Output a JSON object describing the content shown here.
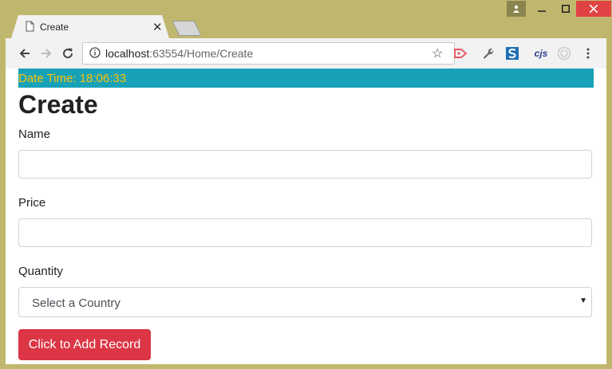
{
  "browser": {
    "tab": {
      "title": "Create"
    },
    "address": {
      "host": "localhost",
      "rest": ":63554/Home/Create"
    },
    "extensions": [
      "arrow-extension-icon",
      "wrench-extension-icon",
      "s-extension-icon",
      "cjs-extension-icon",
      "circle-extension-icon"
    ],
    "ext_cjs_label": "cjs"
  },
  "page": {
    "datetime": "Date Time: 18:06:33",
    "title": "Create",
    "form": {
      "name_label": "Name",
      "price_label": "Price",
      "quantity_label": "Quantity",
      "select_value": "Select a Country",
      "submit_label": "Click to Add Record"
    }
  },
  "colors": {
    "chrome": "#c0b76e",
    "info_bar": "#17a2b8",
    "info_text": "#ffc107",
    "button": "#dc3545"
  }
}
